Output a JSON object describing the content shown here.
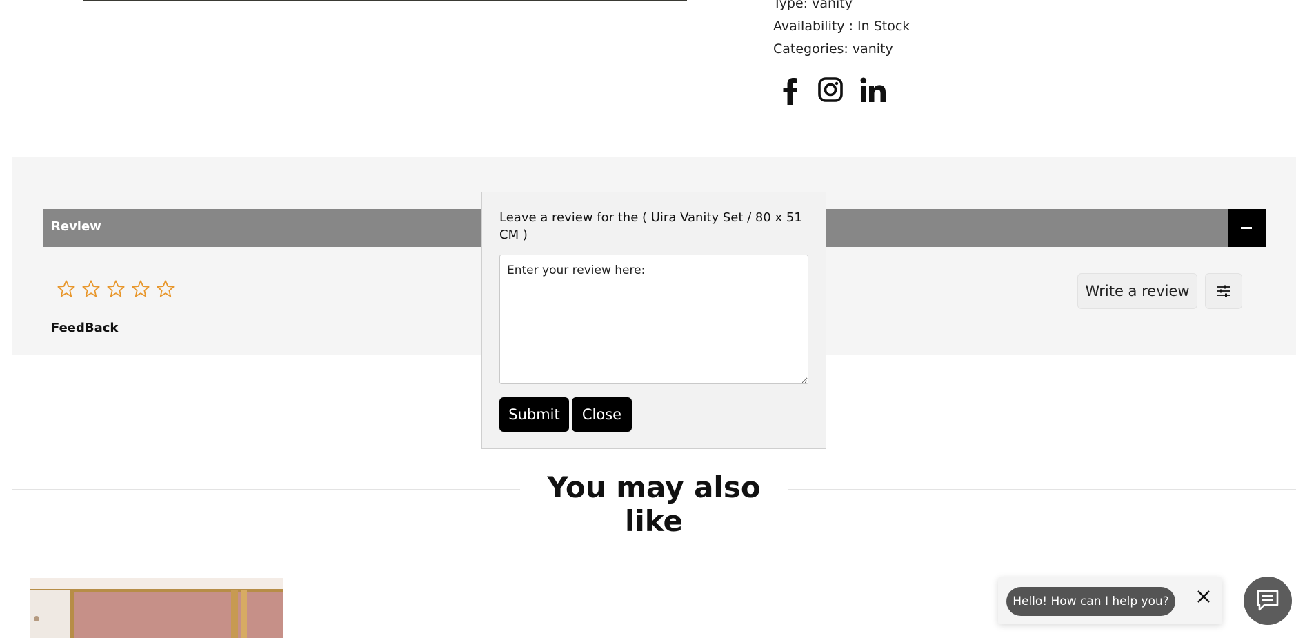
{
  "product_meta": {
    "type": "Type: vanity",
    "availability": "Availability : In Stock",
    "categories": "Categories: vanity"
  },
  "social_icons": [
    "facebook-icon",
    "instagram-icon",
    "linkedin-icon"
  ],
  "review_section": {
    "header_label": "Review",
    "collapse_icon": "minus-icon",
    "rating_stars": 0,
    "rating_max": 5,
    "feedback_label": "FeedBack",
    "write_review_label": "Write a review",
    "filter_icon": "sliders-icon"
  },
  "review_modal": {
    "title": "Leave a review for the ( Uira Vanity Set / 80 x 51 CM )",
    "textarea_placeholder": "Enter your review here:",
    "submit_label": "Submit",
    "close_label": "Close"
  },
  "recommendations": {
    "heading": "You may also like"
  },
  "chat_widget": {
    "greeting": "Hello! How can I help you?",
    "close_icon": "close-icon",
    "launcher_icon": "chat-icon"
  },
  "colors": {
    "star_outline": "#e8962a",
    "review_bar": "#878787",
    "section_bg": "#f5f5f5",
    "button_bg": "#000000",
    "chat_bubble": "#545454"
  }
}
